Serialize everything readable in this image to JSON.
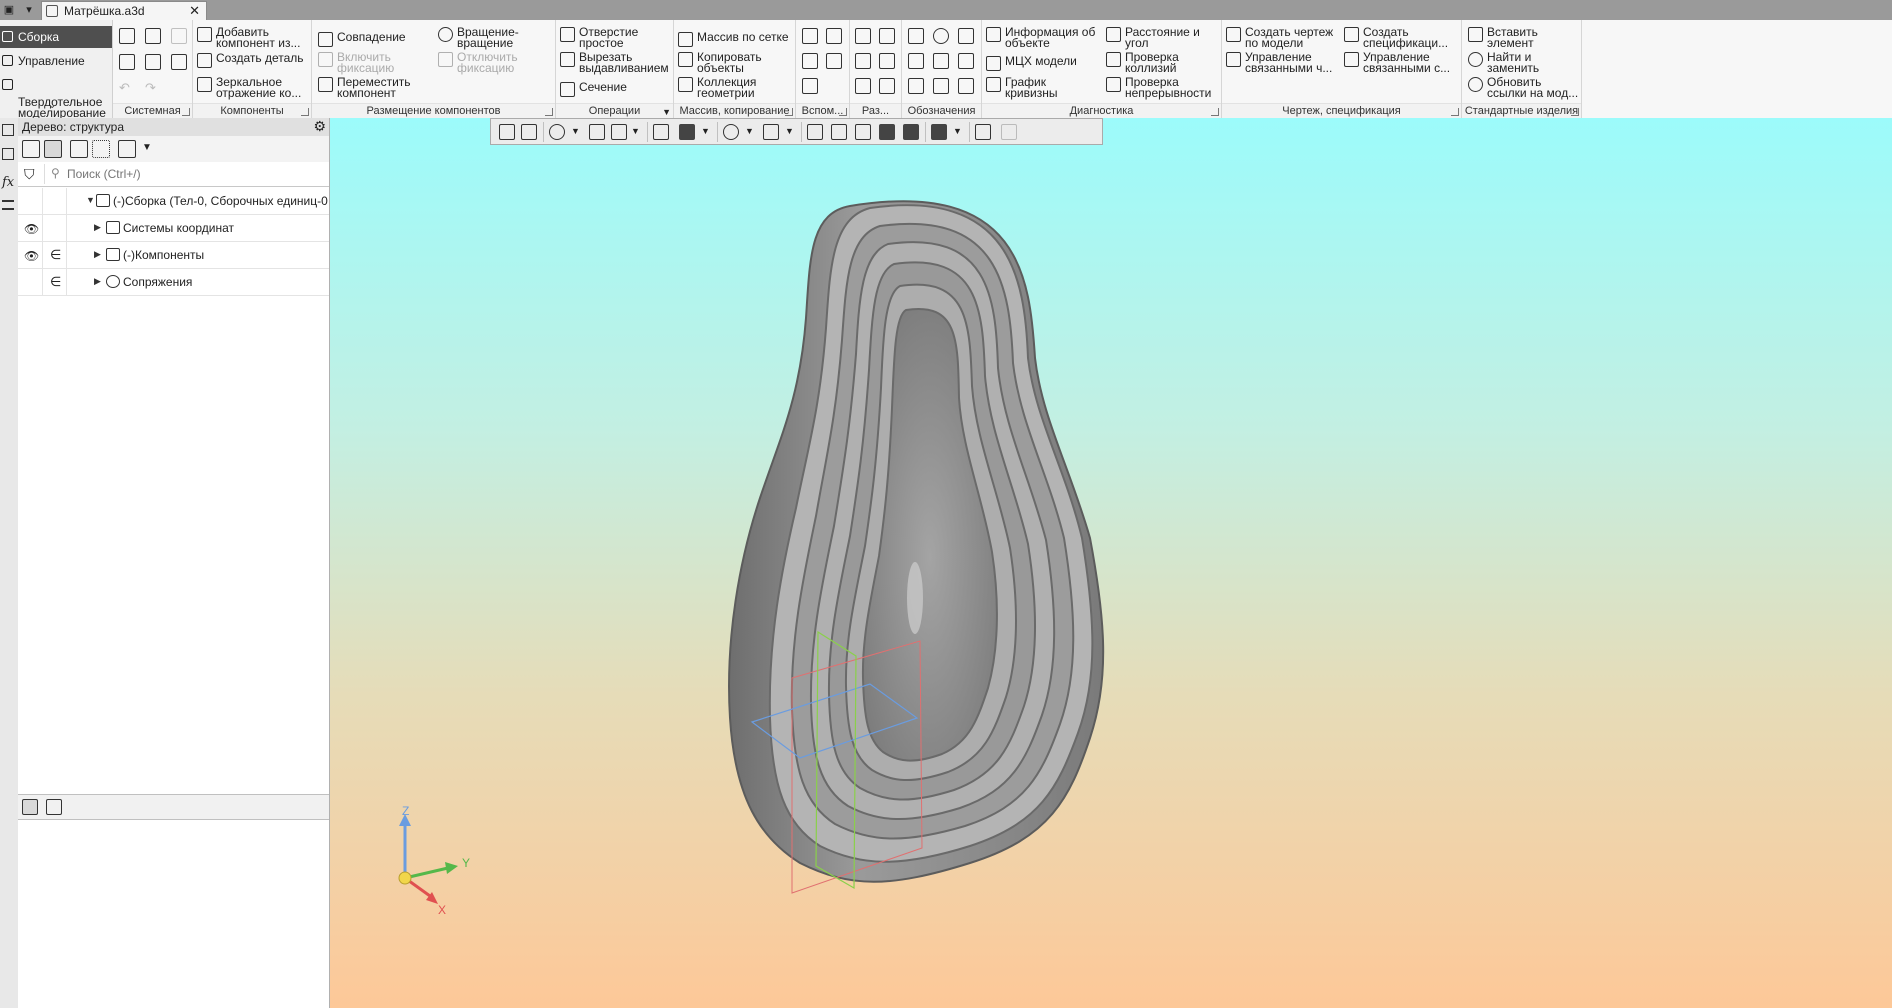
{
  "document_tab": {
    "title": "Матрёшка.a3d",
    "close": "✕"
  },
  "modes": [
    {
      "label": "Сборка"
    },
    {
      "label": "Управление"
    },
    {
      "label": "Твердотельное\nмоделирование"
    }
  ],
  "ribbon": {
    "groups": [
      {
        "title": "Системная"
      },
      {
        "title": "Компоненты"
      },
      {
        "title": "Размещение компонентов"
      },
      {
        "title": "Операции"
      },
      {
        "title": "Массив, копирование"
      },
      {
        "title": "Вспом..."
      },
      {
        "title": "Раз..."
      },
      {
        "title": "Обозначения"
      },
      {
        "title": "Диагностика"
      },
      {
        "title": "Чертеж, спецификация"
      },
      {
        "title": "Стандартные изделия"
      }
    ],
    "components": {
      "add_component": "Добавить\nкомпонент из...",
      "create_part": "Создать деталь",
      "mirror": "Зеркальное\nотражение ко..."
    },
    "placement": {
      "coincidence": "Совпадение",
      "rotation": "Вращение-\nвращение",
      "enable_fix": "Включить\nфиксацию",
      "disable_fix": "Отключить\nфиксацию",
      "move": "Переместить\nкомпонент"
    },
    "operations": {
      "hole": "Отверстие\nпростое",
      "extrude_cut": "Вырезать\nвыдавливанием",
      "section": "Сечение"
    },
    "array": {
      "grid_array": "Массив по сетке",
      "copy_objects": "Копировать\nобъекты",
      "geometry_collection": "Коллекция\nгеометрии"
    },
    "diagnostics": {
      "object_info": "Информация об\nобъекте",
      "distance_angle": "Расстояние и\nугол",
      "mass_props": "МЦХ модели",
      "collision_check": "Проверка\nколлизий",
      "curvature": "График\nкривизны",
      "continuity_check": "Проверка\nнепрерывности"
    },
    "drawing": {
      "create_drawing": "Создать чертеж\nпо модели",
      "create_spec": "Создать\nспецификаци...",
      "manage_linked_drawings": "Управление\nсвязанными ч...",
      "manage_linked_specs": "Управление\nсвязанными с..."
    },
    "standard": {
      "insert": "Вставить\nэлемент",
      "find_replace": "Найти и\nзаменить",
      "update_links": "Обновить\nссылки на мод..."
    }
  },
  "tree": {
    "header": "Дерево: структура",
    "search_placeholder": "Поиск (Ctrl+/)",
    "root": "(-)Сборка (Тел-0, Сборочных единиц-0",
    "items": [
      {
        "label": "Системы координат",
        "visible": true,
        "member": false
      },
      {
        "label": "(-)Компоненты",
        "visible": true,
        "member": true
      },
      {
        "label": "Сопряжения",
        "visible": false,
        "member": true
      }
    ]
  },
  "axes": {
    "x": "X",
    "y": "Y",
    "z": "Z"
  },
  "colors": {
    "viewport_top": "#9cfbfb",
    "viewport_bottom": "#fdc898",
    "model_gray": "#8c8c8c",
    "active_mode": "#4f4f4f"
  }
}
